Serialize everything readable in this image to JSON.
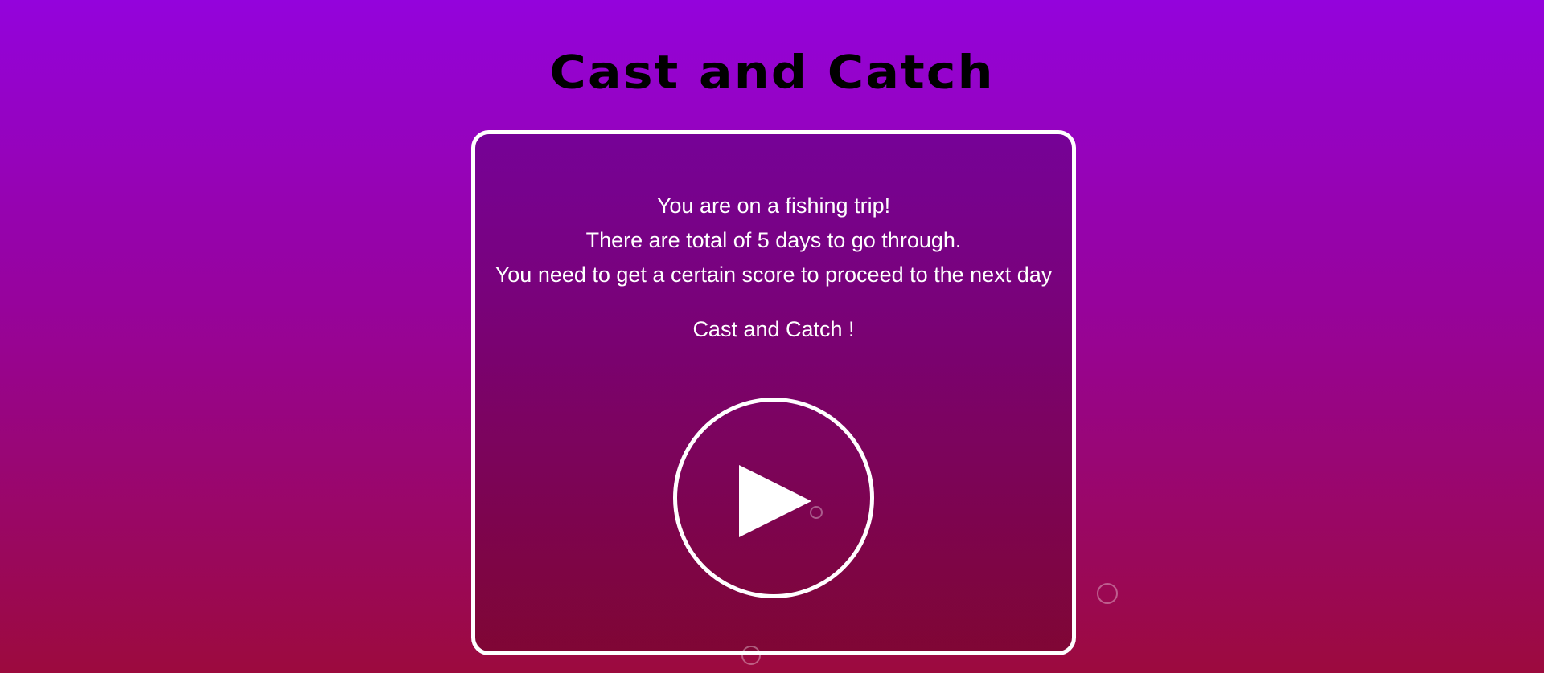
{
  "game": {
    "title": "Cast and Catch"
  },
  "intro": {
    "lines": [
      "You are on a fishing trip!",
      "There are total of 5 days to go through.",
      "You need to get a certain score to proceed to the next day"
    ],
    "call_to_action": "Cast and Catch !"
  },
  "play_button": {
    "icon": "play-icon"
  },
  "colors": {
    "background_top": "#9403dc",
    "background_bottom": "#9c0a3e",
    "title_text": "#000000",
    "panel_border": "#ffffff",
    "body_text": "#ffffff"
  }
}
